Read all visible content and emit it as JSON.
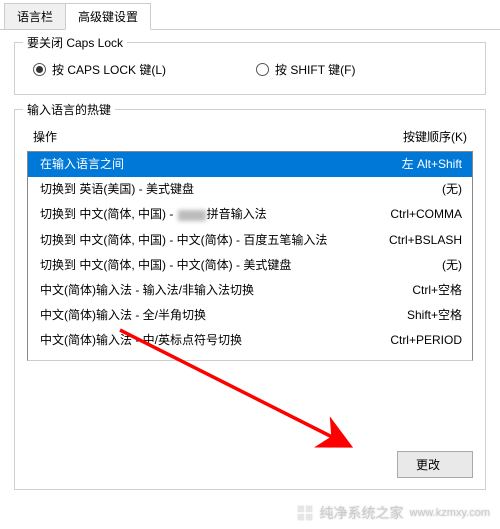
{
  "tabs": {
    "language_bar": "语言栏",
    "advanced": "高级键设置"
  },
  "capslock_group": {
    "legend": "要关闭 Caps Lock",
    "opt_caps": "按 CAPS LOCK 键(L)",
    "opt_shift": "按 SHIFT 键(F)"
  },
  "hotkey_group": {
    "legend": "输入语言的热键",
    "col_action": "操作",
    "col_keys": "按键顺序(K)",
    "rows": [
      {
        "action": "在输入语言之间",
        "keys": "左 Alt+Shift"
      },
      {
        "action": "切换到 英语(美国) - 美式键盘",
        "keys": "(无)"
      },
      {
        "action_prefix": "切换到 中文(简体, 中国) - ",
        "action_suffix": "拼音输入法",
        "keys": "Ctrl+COMMA",
        "blurred": true
      },
      {
        "action": "切换到 中文(简体, 中国) - 中文(简体) - 百度五笔输入法",
        "keys": "Ctrl+BSLASH"
      },
      {
        "action": "切换到 中文(简体, 中国) - 中文(简体) - 美式键盘",
        "keys": "(无)"
      },
      {
        "action": "中文(简体)输入法 - 输入法/非输入法切换",
        "keys": "Ctrl+空格"
      },
      {
        "action": "中文(简体)输入法 - 全/半角切换",
        "keys": "Shift+空格"
      },
      {
        "action": "中文(简体)输入法 - 中/英标点符号切换",
        "keys": "Ctrl+PERIOD"
      }
    ]
  },
  "buttons": {
    "change": "更改"
  },
  "watermark": {
    "text": "纯净系统之家",
    "url": "www.kzmxy.com"
  }
}
